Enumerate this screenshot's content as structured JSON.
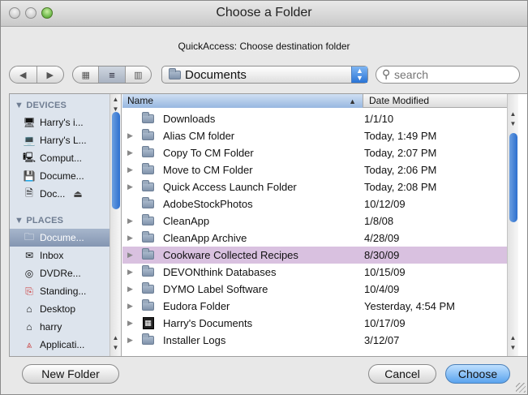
{
  "window": {
    "title": "Choose a Folder"
  },
  "prompt": "QuickAccess: Choose destination folder",
  "toolbar": {
    "back_icon": "back-arrow-icon",
    "forward_icon": "forward-arrow-icon",
    "view_modes": [
      "icon-view",
      "list-view",
      "column-view"
    ],
    "active_view": "list-view",
    "location": "Documents",
    "search_placeholder": "search"
  },
  "sidebar": {
    "devices_label": "▼ DEVICES",
    "places_label": "▼ PLACES",
    "devices": [
      {
        "label": "Harry's i...",
        "icon": "display-icon"
      },
      {
        "label": "Harry's L...",
        "icon": "laptop-icon"
      },
      {
        "label": "Comput...",
        "icon": "computer-icon"
      },
      {
        "label": "Docume...",
        "icon": "disk-image-icon"
      },
      {
        "label": "Doc...",
        "icon": "document-disk-icon",
        "eject": "⏏"
      }
    ],
    "places": [
      {
        "label": "Docume...",
        "icon": "documents-folder-icon",
        "selected": true
      },
      {
        "label": "Inbox",
        "icon": "inbox-icon"
      },
      {
        "label": "DVDRe...",
        "icon": "dvd-icon"
      },
      {
        "label": "Standing...",
        "icon": "pdf-icon"
      },
      {
        "label": "Desktop",
        "icon": "home-icon"
      },
      {
        "label": "harry",
        "icon": "home-icon"
      },
      {
        "label": "Applicati...",
        "icon": "applications-icon"
      }
    ]
  },
  "list": {
    "columns": {
      "name": "Name",
      "date": "Date Modified"
    },
    "rows": [
      {
        "name": "Downloads",
        "date": "1/1/10",
        "icon": "downloads-folder-icon",
        "expandable": false
      },
      {
        "name": "Alias CM folder",
        "date": "Today, 1:49 PM",
        "icon": "folder-icon",
        "expandable": true
      },
      {
        "name": "Copy To CM Folder",
        "date": "Today, 2:07 PM",
        "icon": "folder-icon",
        "expandable": true
      },
      {
        "name": "Move to CM Folder",
        "date": "Today, 2:06 PM",
        "icon": "folder-icon",
        "expandable": true
      },
      {
        "name": "Quick Access Launch Folder",
        "date": "Today, 2:08 PM",
        "icon": "folder-icon",
        "expandable": true
      },
      {
        "name": "AdobeStockPhotos",
        "date": "10/12/09",
        "icon": "folder-icon",
        "expandable": false
      },
      {
        "name": "CleanApp",
        "date": "1/8/08",
        "icon": "folder-icon",
        "expandable": true
      },
      {
        "name": "CleanApp Archive",
        "date": "4/28/09",
        "icon": "folder-icon",
        "expandable": true
      },
      {
        "name": "Cookware Collected Recipes",
        "date": "8/30/09",
        "icon": "folder-icon",
        "expandable": true,
        "highlight": true
      },
      {
        "name": "DEVONthink Databases",
        "date": "10/15/09",
        "icon": "folder-icon",
        "expandable": true
      },
      {
        "name": "DYMO Label Software",
        "date": "10/4/09",
        "icon": "folder-icon",
        "expandable": true
      },
      {
        "name": "Eudora Folder",
        "date": "Yesterday, 4:54 PM",
        "icon": "folder-icon",
        "expandable": true
      },
      {
        "name": "Harry's Documents",
        "date": "10/17/09",
        "icon": "special-folder-icon",
        "expandable": true
      },
      {
        "name": "Installer Logs",
        "date": "3/12/07",
        "icon": "folder-icon",
        "expandable": true
      }
    ]
  },
  "buttons": {
    "new_folder": "New Folder",
    "cancel": "Cancel",
    "choose": "Choose"
  },
  "colors": {
    "highlight_row": "#d9c1e0",
    "sidebar_bg": "#dde4ed",
    "selection": "#8496b2",
    "primary_button": "#5aa3ee"
  }
}
